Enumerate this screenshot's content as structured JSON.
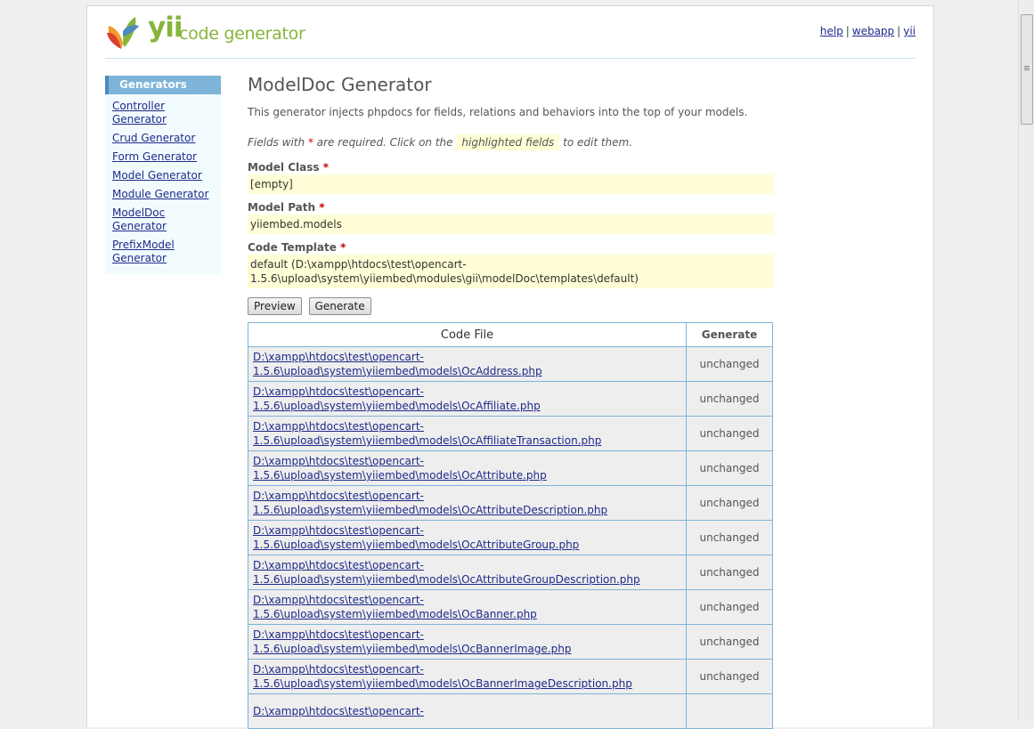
{
  "header": {
    "logo_yii": "yii",
    "logo_text": "code generator",
    "links": [
      "help",
      "webapp",
      "yii"
    ]
  },
  "sidebar": {
    "title": "Generators",
    "items": [
      "Controller Generator",
      "Crud Generator",
      "Form Generator",
      "Model Generator",
      "Module Generator",
      "ModelDoc Generator",
      "PrefixModel Generator"
    ]
  },
  "main": {
    "title": "ModelDoc Generator",
    "description": "This generator injects phpdocs for fields, relations and behaviors into the top of your models.",
    "hint_part1": "Fields with",
    "hint_star": "*",
    "hint_part2": "are required. Click on the",
    "hint_highlight": "highlighted fields",
    "hint_part3": "to edit them.",
    "fields": [
      {
        "label": "Model Class",
        "value": "[empty]"
      },
      {
        "label": "Model Path",
        "value": "yiiembed.models"
      },
      {
        "label": "Code Template",
        "value": "default (D:\\xampp\\htdocs\\test\\opencart-1.5.6\\upload\\system\\yiiembed\\modules\\gii\\modelDoc\\templates\\default)"
      }
    ],
    "preview_button": "Preview",
    "generate_button": "Generate",
    "table": {
      "col_file": "Code File",
      "col_generate": "Generate",
      "rows": [
        {
          "path1": "D:\\xampp\\htdocs\\test\\opencart-",
          "path2": "1.5.6\\upload\\system\\yiiembed\\models\\OcAddress.php",
          "status": "unchanged"
        },
        {
          "path1": "D:\\xampp\\htdocs\\test\\opencart-",
          "path2": "1.5.6\\upload\\system\\yiiembed\\models\\OcAffiliate.php",
          "status": "unchanged"
        },
        {
          "path1": "D:\\xampp\\htdocs\\test\\opencart-",
          "path2": "1.5.6\\upload\\system\\yiiembed\\models\\OcAffiliateTransaction.php",
          "status": "unchanged"
        },
        {
          "path1": "D:\\xampp\\htdocs\\test\\opencart-",
          "path2": "1.5.6\\upload\\system\\yiiembed\\models\\OcAttribute.php",
          "status": "unchanged"
        },
        {
          "path1": "D:\\xampp\\htdocs\\test\\opencart-",
          "path2": "1.5.6\\upload\\system\\yiiembed\\models\\OcAttributeDescription.php",
          "status": "unchanged"
        },
        {
          "path1": "D:\\xampp\\htdocs\\test\\opencart-",
          "path2": "1.5.6\\upload\\system\\yiiembed\\models\\OcAttributeGroup.php",
          "status": "unchanged"
        },
        {
          "path1": "D:\\xampp\\htdocs\\test\\opencart-",
          "path2": "1.5.6\\upload\\system\\yiiembed\\models\\OcAttributeGroupDescription.php",
          "status": "unchanged"
        },
        {
          "path1": "D:\\xampp\\htdocs\\test\\opencart-",
          "path2": "1.5.6\\upload\\system\\yiiembed\\models\\OcBanner.php",
          "status": "unchanged"
        },
        {
          "path1": "D:\\xampp\\htdocs\\test\\opencart-",
          "path2": "1.5.6\\upload\\system\\yiiembed\\models\\OcBannerImage.php",
          "status": "unchanged"
        },
        {
          "path1": "D:\\xampp\\htdocs\\test\\opencart-",
          "path2": "1.5.6\\upload\\system\\yiiembed\\models\\OcBannerImageDescription.php",
          "status": "unchanged"
        },
        {
          "path1": "D:\\xampp\\htdocs\\test\\opencart-",
          "path2": "",
          "status": ""
        }
      ]
    }
  }
}
